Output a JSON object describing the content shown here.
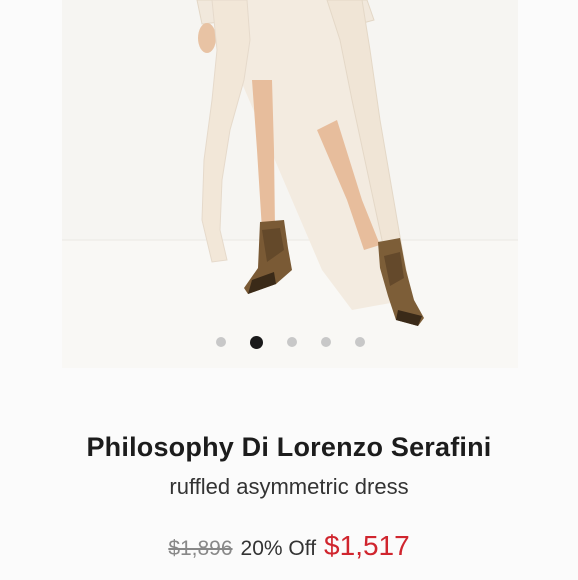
{
  "product": {
    "brand": "Philosophy Di Lorenzo Serafini",
    "name": "ruffled asymmetric dress",
    "original_price": "$1,896",
    "discount": "20% Off",
    "sale_price": "$1,517"
  },
  "gallery": {
    "image_subject": "model-wearing-dress-and-snakeskin-boots",
    "dot_count": 5,
    "active_index": 1
  },
  "colors": {
    "sale_price": "#d0252e",
    "active_dot": "#1a1a1a",
    "inactive_dot": "#c8c8c8"
  }
}
